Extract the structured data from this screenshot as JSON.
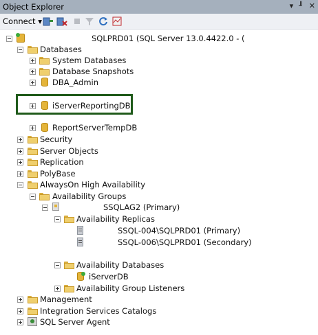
{
  "title": "Object Explorer",
  "title_controls": [
    "▾",
    "╜",
    "✕"
  ],
  "toolbar": {
    "connect_label": "Connect ▾"
  },
  "icons": {
    "connect_db": "connect-database-icon",
    "disconnect": "disconnect-icon",
    "stop": "stop-icon",
    "filter": "filter-icon",
    "refresh": "refresh-icon",
    "activity_monitor": "activity-monitor-icon"
  },
  "tree": {
    "server": "SQLPRD01 (SQL Server 13.0.4422.0 - (",
    "databases": "Databases",
    "system_databases": "System Databases",
    "database_snapshots": "Database Snapshots",
    "dba_admin": "DBA_Admin",
    "iserver_reporting_db": "iServerReportingDB",
    "report_server_temp_db": "ReportServerTempDB",
    "security": "Security",
    "server_objects": "Server Objects",
    "replication": "Replication",
    "polybase": "PolyBase",
    "always_on": "AlwaysOn High Availability",
    "availability_groups": "Availability Groups",
    "ag_name": "SSQLAG2 (Primary)",
    "availability_replicas": "Availability Replicas",
    "replica_1": "SSQL-004\\SQLPRD01 (Primary)",
    "replica_2": "SSQL-006\\SQLPRD01 (Secondary)",
    "availability_databases": "Availability Databases",
    "iserver_db": "iServerDB",
    "ag_listeners": "Availability Group Listeners",
    "management": "Management",
    "integration_services": "Integration Services Catalogs",
    "sql_agent": "SQL Server Agent"
  }
}
